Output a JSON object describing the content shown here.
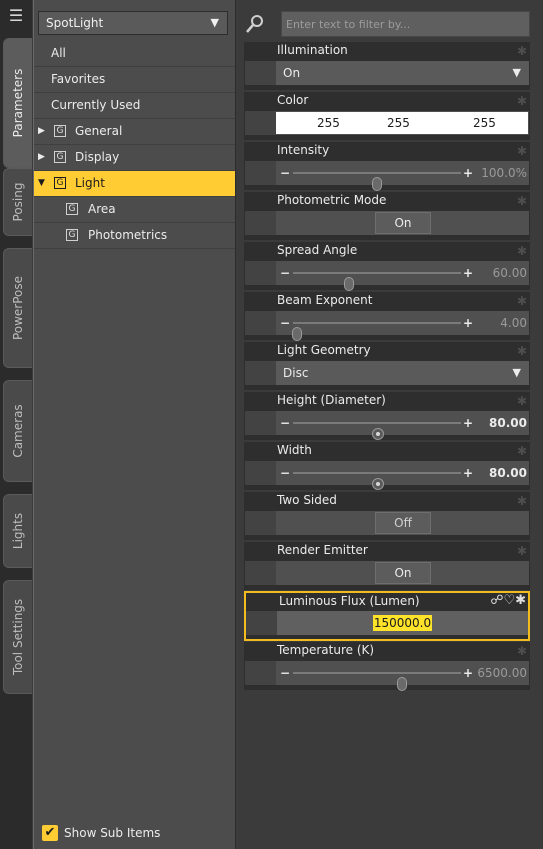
{
  "tabs": [
    {
      "label": "Parameters",
      "active": true
    },
    {
      "label": "Posing",
      "active": false
    },
    {
      "label": "PowerPose",
      "active": false
    },
    {
      "label": "Cameras",
      "active": false
    },
    {
      "label": "Lights",
      "active": false
    },
    {
      "label": "Tool Settings",
      "active": false
    }
  ],
  "node_selector": {
    "value": "SpotLight"
  },
  "tree": [
    {
      "label": "All"
    },
    {
      "label": "Favorites"
    },
    {
      "label": "Currently Used"
    },
    {
      "label": "General"
    },
    {
      "label": "Display"
    },
    {
      "label": "Light"
    },
    {
      "label": "Area"
    },
    {
      "label": "Photometrics"
    }
  ],
  "show_sub_items": {
    "label": "Show Sub Items",
    "checked": true
  },
  "filter": {
    "placeholder": "Enter text to filter by..."
  },
  "properties": {
    "illumination": {
      "name": "Illumination",
      "value": "On"
    },
    "color": {
      "name": "Color",
      "r": "255",
      "g": "255",
      "b": "255"
    },
    "intensity": {
      "name": "Intensity",
      "value": "100.0%",
      "level": 0.5
    },
    "photometric_mode": {
      "name": "Photometric Mode",
      "value": "On"
    },
    "spread_angle": {
      "name": "Spread Angle",
      "value": "60.00",
      "level": 0.33
    },
    "beam_exponent": {
      "name": "Beam Exponent",
      "value": "4.00",
      "level": 0.02
    },
    "light_geometry": {
      "name": "Light Geometry",
      "value": "Disc"
    },
    "height": {
      "name": "Height (Diameter)",
      "value": "80.00",
      "level": 0.5
    },
    "width": {
      "name": "Width",
      "value": "80.00",
      "level": 0.5
    },
    "two_sided": {
      "name": "Two Sided",
      "value": "Off"
    },
    "render_emitter": {
      "name": "Render Emitter",
      "value": "On"
    },
    "luminous_flux": {
      "name": "Luminous Flux (Lumen)",
      "value": "150000.0"
    },
    "temperature": {
      "name": "Temperature (K)",
      "value": "6500.00",
      "level": 0.65
    }
  },
  "icons": {
    "menu": "menu-icon",
    "search": "search-icon",
    "gear": "gear-icon",
    "chain": "chain-icon",
    "heart": "heart-icon"
  },
  "colors": {
    "accent": "#ffcc33",
    "highlight_border": "#f2bc1e",
    "edit_highlight": "#ffe32a"
  }
}
